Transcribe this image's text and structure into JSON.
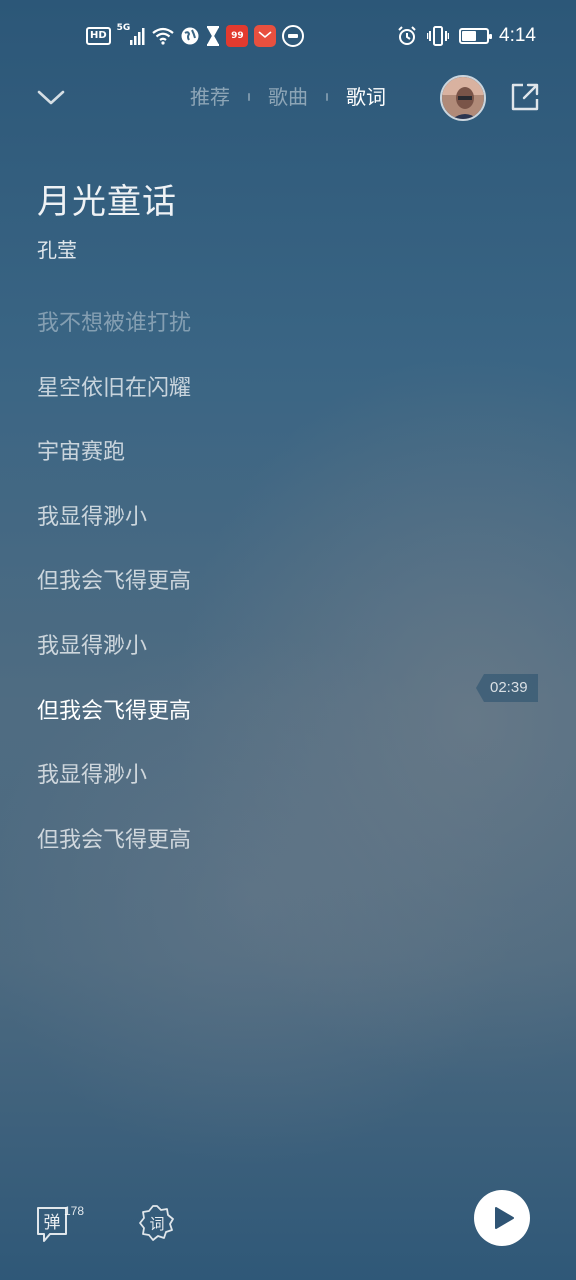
{
  "status_bar": {
    "hd": "HD",
    "network": "5G",
    "app_badge_1": "99",
    "time": "4:14",
    "battery_level": 0.55,
    "icons": [
      "hd-icon",
      "signal-icon",
      "wifi-icon",
      "globe-icon",
      "hourglass-icon",
      "app-icon",
      "mail-app-icon",
      "round-app-icon",
      "alarm-icon",
      "vibrate-icon",
      "battery-icon"
    ]
  },
  "header": {
    "tabs": [
      {
        "label": "推荐",
        "active": false
      },
      {
        "label": "歌曲",
        "active": false
      },
      {
        "label": "歌词",
        "active": true
      }
    ]
  },
  "song": {
    "title": "月光童话",
    "artist": "孔莹"
  },
  "lyrics": [
    {
      "text": "我不想被谁打扰",
      "state": "faded"
    },
    {
      "text": "星空依旧在闪耀",
      "state": "normal"
    },
    {
      "text": "宇宙赛跑",
      "state": "normal"
    },
    {
      "text": "我显得渺小",
      "state": "normal"
    },
    {
      "text": "但我会飞得更高",
      "state": "normal"
    },
    {
      "text": "我显得渺小",
      "state": "normal"
    },
    {
      "text": "但我会飞得更高",
      "state": "current"
    },
    {
      "text": "我显得渺小",
      "state": "normal"
    },
    {
      "text": "但我会飞得更高",
      "state": "normal"
    }
  ],
  "current_time": "02:39",
  "bottom": {
    "danmu_label": "弹",
    "danmu_count": "178",
    "lyric_label": "词"
  },
  "colors": {
    "bg_top": "#2c5778",
    "bg_mid": "#4f6c82",
    "text_primary": "#ffffff"
  }
}
